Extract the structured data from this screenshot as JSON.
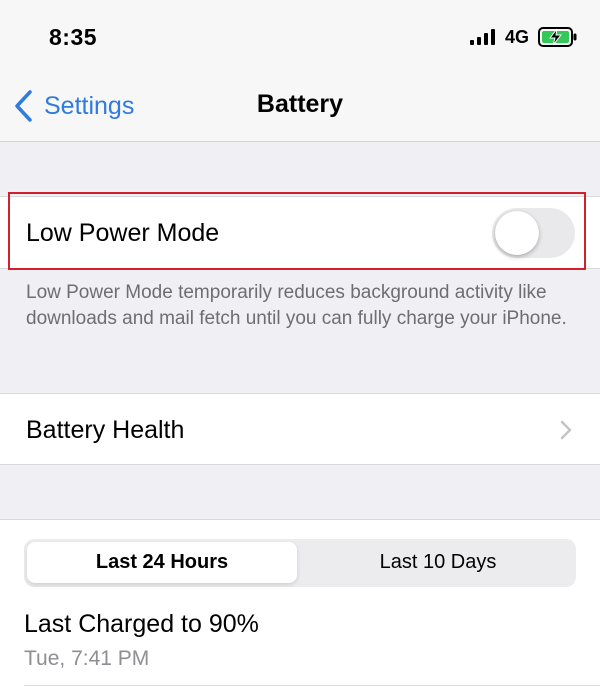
{
  "status_bar": {
    "time": "8:35",
    "network": "4G",
    "signal_icon": "cellular-signal-icon",
    "battery_icon": "battery-charging-icon",
    "battery_color": "#34c759"
  },
  "nav": {
    "back_label": "Settings",
    "title": "Battery",
    "accent": "#2f7bde"
  },
  "low_power": {
    "label": "Low Power Mode",
    "enabled": false,
    "footer": "Low Power Mode temporarily reduces background activity like downloads and mail fetch until you can fully charge your iPhone.",
    "highlight_color": "#d0202e"
  },
  "battery_health": {
    "label": "Battery Health"
  },
  "usage": {
    "tabs": [
      {
        "label": "Last 24 Hours",
        "selected": true
      },
      {
        "label": "Last 10 Days",
        "selected": false
      }
    ],
    "last_charged_title": "Last Charged to 90%",
    "last_charged_time": "Tue, 7:41 PM"
  }
}
